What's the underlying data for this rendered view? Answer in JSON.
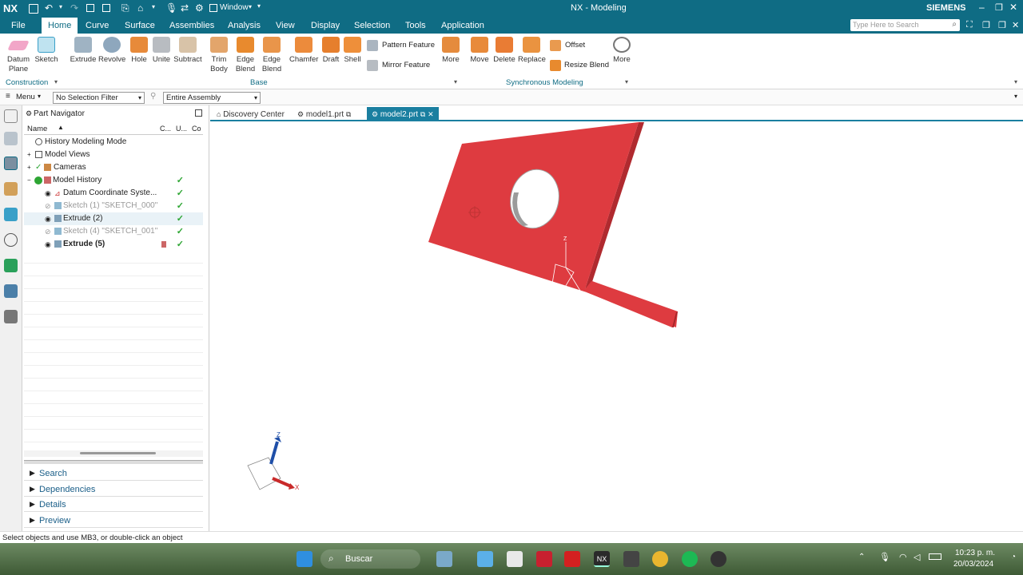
{
  "titlebar": {
    "logo": "NX",
    "window_menu": "Window",
    "title": "NX - Modeling",
    "brand": "SIEMENS",
    "search_placeholder": "Type Here to Search"
  },
  "menu": {
    "items": [
      "File",
      "Home",
      "Curve",
      "Surface",
      "Assemblies",
      "Analysis",
      "View",
      "Display",
      "Selection",
      "Tools",
      "Application"
    ],
    "active": "Home"
  },
  "ribbon": {
    "construction": {
      "datum_plane": "Datum Plane",
      "sketch": "Sketch",
      "group_label": "Construction"
    },
    "base": {
      "buttons": [
        "Extrude",
        "Revolve",
        "Hole",
        "Unite",
        "Subtract",
        "Trim Body",
        "Edge Blend",
        "Edge Blend",
        "Chamfer",
        "Draft",
        "Shell"
      ],
      "pattern_feature": "Pattern Feature",
      "mirror_feature": "Mirror Feature",
      "more": "More",
      "group_label": "Base"
    },
    "sync": {
      "buttons": [
        "Move",
        "Delete",
        "Replace"
      ],
      "offset": "Offset",
      "resize_blend": "Resize Blend",
      "more": "More",
      "group_label": "Synchronous Modeling"
    }
  },
  "selection_bar": {
    "menu": "Menu",
    "filter": "No Selection Filter",
    "scope": "Entire Assembly"
  },
  "navigator": {
    "title": "Part Navigator",
    "col_name": "Name",
    "col_c": "C...",
    "col_u": "U...",
    "col_co": "Co",
    "rows": [
      {
        "label": "History Modeling Mode",
        "check": ""
      },
      {
        "label": "Model Views",
        "check": ""
      },
      {
        "label": "Cameras",
        "check": ""
      },
      {
        "label": "Model History",
        "check": "✓"
      },
      {
        "label": "Datum Coordinate Syste...",
        "check": "✓"
      },
      {
        "label": "Sketch (1) \"SKETCH_000\"",
        "check": "✓"
      },
      {
        "label": "Extrude (2)",
        "check": "✓"
      },
      {
        "label": "Sketch (4) \"SKETCH_001\"",
        "check": "✓"
      },
      {
        "label": "Extrude (5)",
        "check": "✓"
      }
    ],
    "panels": [
      "Search",
      "Dependencies",
      "Details",
      "Preview"
    ]
  },
  "tabs": [
    {
      "label": "Discovery Center"
    },
    {
      "label": "model1.prt"
    },
    {
      "label": "model2.prt"
    }
  ],
  "viewport": {
    "triad": {
      "z": "Z",
      "x": "X"
    },
    "part_color": "#de3b40"
  },
  "status_text": "Select objects and use MB3, or double-click an object",
  "taskbar": {
    "search_text": "Buscar",
    "time": "10:23 p. m.",
    "date": "20/03/2024"
  }
}
